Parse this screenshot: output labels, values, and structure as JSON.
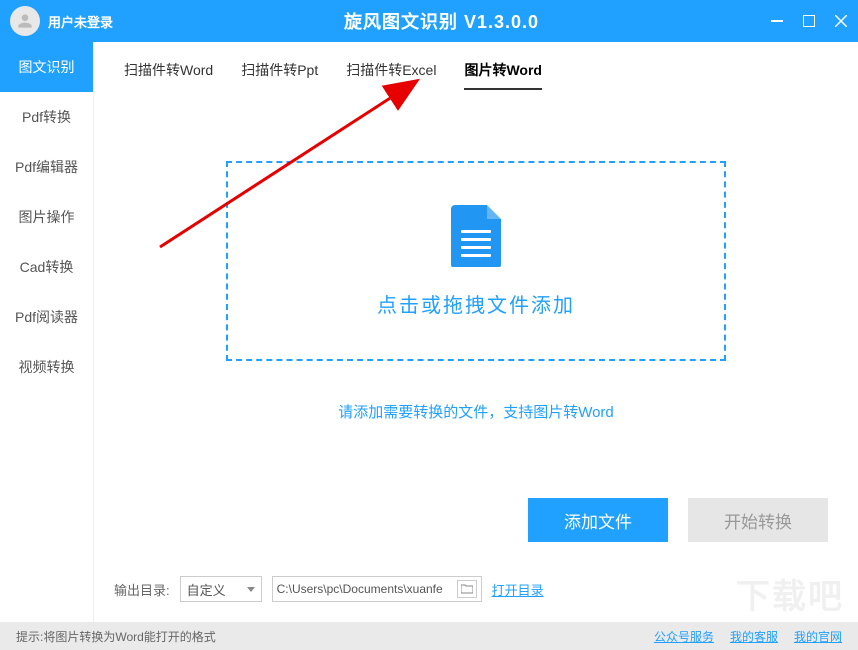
{
  "header": {
    "login_status": "用户未登录",
    "title": "旋风图文识别 V1.3.0.0"
  },
  "sidebar": {
    "items": [
      {
        "label": "图文识别",
        "active": true
      },
      {
        "label": "Pdf转换",
        "active": false
      },
      {
        "label": "Pdf编辑器",
        "active": false
      },
      {
        "label": "图片操作",
        "active": false
      },
      {
        "label": "Cad转换",
        "active": false
      },
      {
        "label": "Pdf阅读器",
        "active": false
      },
      {
        "label": "视频转换",
        "active": false
      }
    ]
  },
  "tabs": [
    {
      "label": "扫描件转Word",
      "active": false
    },
    {
      "label": "扫描件转Ppt",
      "active": false
    },
    {
      "label": "扫描件转Excel",
      "active": false
    },
    {
      "label": "图片转Word",
      "active": true
    }
  ],
  "drop": {
    "text": "点击或拖拽文件添加",
    "hint": "请添加需要转换的文件，支持图片转Word"
  },
  "buttons": {
    "add": "添加文件",
    "start": "开始转换"
  },
  "output": {
    "label": "输出目录:",
    "select_value": "自定义",
    "path": "C:\\Users\\pc\\Documents\\xuanfe",
    "open_dir": "打开目录"
  },
  "status": {
    "tip": "提示:将图片转换为Word能打开的格式",
    "links": [
      "公众号服务",
      "我的客服",
      "我的官网"
    ]
  },
  "watermark": "下载吧"
}
